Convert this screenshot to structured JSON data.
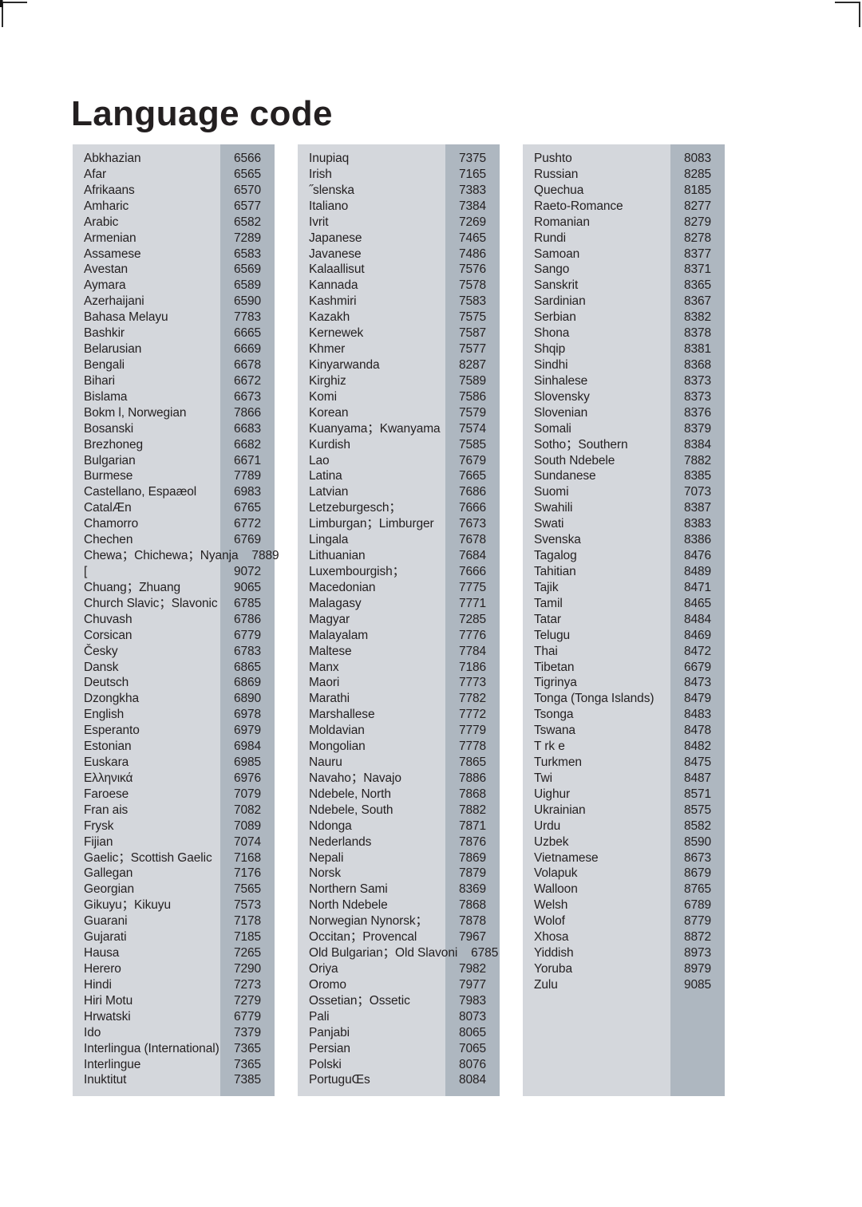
{
  "page": {
    "title": "Language code",
    "colors": {
      "band_light": "#d4d7dc",
      "band_dark": "#aeb7c0",
      "text": "#231f20"
    }
  },
  "columns": [
    {
      "id": "column-1",
      "entries": [
        {
          "language": "Abkhazian",
          "code": "6566"
        },
        {
          "language": "Afar",
          "code": "6565"
        },
        {
          "language": "Afrikaans",
          "code": "6570"
        },
        {
          "language": "Amharic",
          "code": "6577"
        },
        {
          "language": "Arabic",
          "code": "6582"
        },
        {
          "language": "Armenian",
          "code": "7289"
        },
        {
          "language": "Assamese",
          "code": "6583"
        },
        {
          "language": "Avestan",
          "code": "6569"
        },
        {
          "language": "Aymara",
          "code": "6589"
        },
        {
          "language": "Azerhaijani",
          "code": "6590"
        },
        {
          "language": "Bahasa Melayu",
          "code": "7783"
        },
        {
          "language": "Bashkir",
          "code": "6665"
        },
        {
          "language": "Belarusian",
          "code": "6669"
        },
        {
          "language": "Bengali",
          "code": "6678"
        },
        {
          "language": "Bihari",
          "code": "6672"
        },
        {
          "language": "Bislama",
          "code": "6673"
        },
        {
          "language": "Bokm l, Norwegian",
          "code": "7866"
        },
        {
          "language": "Bosanski",
          "code": "6683"
        },
        {
          "language": "Brezhoneg",
          "code": "6682"
        },
        {
          "language": "Bulgarian",
          "code": "6671"
        },
        {
          "language": "Burmese",
          "code": "7789"
        },
        {
          "language": "Castellano, Espaæol",
          "code": "6983"
        },
        {
          "language": "CatalÆn",
          "code": "6765"
        },
        {
          "language": "Chamorro",
          "code": "6772"
        },
        {
          "language": "Chechen",
          "code": "6769"
        },
        {
          "language": "Chewa；Chichewa；Nyanja",
          "code": "7889"
        },
        {
          "language": "[",
          "code": "9072"
        },
        {
          "language": "Chuang；Zhuang",
          "code": "9065"
        },
        {
          "language": "Church Slavic；Slavonic",
          "code": "6785"
        },
        {
          "language": "Chuvash",
          "code": "6786"
        },
        {
          "language": "Corsican",
          "code": "6779"
        },
        {
          "language": "Česky",
          "code": "6783"
        },
        {
          "language": "Dansk",
          "code": "6865"
        },
        {
          "language": "Deutsch",
          "code": "6869"
        },
        {
          "language": "Dzongkha",
          "code": "6890"
        },
        {
          "language": "English",
          "code": "6978"
        },
        {
          "language": "Esperanto",
          "code": "6979"
        },
        {
          "language": "Estonian",
          "code": "6984"
        },
        {
          "language": "Euskara",
          "code": "6985"
        },
        {
          "language": "Ελληνικά",
          "code": "6976"
        },
        {
          "language": "Faroese",
          "code": "7079"
        },
        {
          "language": "Fran ais",
          "code": "7082"
        },
        {
          "language": "Frysk",
          "code": "7089"
        },
        {
          "language": "Fijian",
          "code": "7074"
        },
        {
          "language": "Gaelic；Scottish Gaelic",
          "code": "7168"
        },
        {
          "language": "Gallegan",
          "code": "7176"
        },
        {
          "language": "Georgian",
          "code": "7565"
        },
        {
          "language": "Gikuyu；Kikuyu",
          "code": "7573"
        },
        {
          "language": "Guarani",
          "code": "7178"
        },
        {
          "language": "Gujarati",
          "code": "7185"
        },
        {
          "language": "Hausa",
          "code": "7265"
        },
        {
          "language": "Herero",
          "code": "7290"
        },
        {
          "language": "Hindi",
          "code": "7273"
        },
        {
          "language": "Hiri Motu",
          "code": "7279"
        },
        {
          "language": "Hrwatski",
          "code": "6779"
        },
        {
          "language": "Ido",
          "code": "7379"
        },
        {
          "language": "Interlingua (International)",
          "code": "7365"
        },
        {
          "language": "Interlingue",
          "code": "7365"
        },
        {
          "language": "Inuktitut",
          "code": "7385"
        }
      ]
    },
    {
      "id": "column-2",
      "entries": [
        {
          "language": "Inupiaq",
          "code": "7375"
        },
        {
          "language": "Irish",
          "code": "7165"
        },
        {
          "language": "˝slenska",
          "code": "7383"
        },
        {
          "language": "Italiano",
          "code": "7384"
        },
        {
          "language": "Ivrit",
          "code": "7269"
        },
        {
          "language": "Japanese",
          "code": "7465"
        },
        {
          "language": "Javanese",
          "code": "7486"
        },
        {
          "language": "Kalaallisut",
          "code": "7576"
        },
        {
          "language": "Kannada",
          "code": "7578"
        },
        {
          "language": "Kashmiri",
          "code": "7583"
        },
        {
          "language": "Kazakh",
          "code": "7575"
        },
        {
          "language": "Kernewek",
          "code": "7587"
        },
        {
          "language": "Khmer",
          "code": "7577"
        },
        {
          "language": "Kinyarwanda",
          "code": "8287"
        },
        {
          "language": "Kirghiz",
          "code": "7589"
        },
        {
          "language": "Komi",
          "code": "7586"
        },
        {
          "language": "Korean",
          "code": "7579"
        },
        {
          "language": "Kuanyama；Kwanyama",
          "code": "7574"
        },
        {
          "language": "Kurdish",
          "code": "7585"
        },
        {
          "language": "Lao",
          "code": "7679"
        },
        {
          "language": "Latina",
          "code": "7665"
        },
        {
          "language": "Latvian",
          "code": "7686"
        },
        {
          "language": "Letzeburgesch；",
          "code": "7666"
        },
        {
          "language": "Limburgan；Limburger",
          "code": "7673"
        },
        {
          "language": "Lingala",
          "code": "7678"
        },
        {
          "language": "Lithuanian",
          "code": "7684"
        },
        {
          "language": "Luxembourgish；",
          "code": "7666"
        },
        {
          "language": "Macedonian",
          "code": "7775"
        },
        {
          "language": "Malagasy",
          "code": "7771"
        },
        {
          "language": "Magyar",
          "code": "7285"
        },
        {
          "language": "Malayalam",
          "code": "7776"
        },
        {
          "language": "Maltese",
          "code": "7784"
        },
        {
          "language": "Manx",
          "code": "7186"
        },
        {
          "language": "Maori",
          "code": "7773"
        },
        {
          "language": "Marathi",
          "code": "7782"
        },
        {
          "language": "Marshallese",
          "code": "7772"
        },
        {
          "language": "Moldavian",
          "code": "7779"
        },
        {
          "language": "Mongolian",
          "code": "7778"
        },
        {
          "language": "Nauru",
          "code": "7865"
        },
        {
          "language": "Navaho；Navajo",
          "code": "7886"
        },
        {
          "language": "Ndebele, North",
          "code": "7868"
        },
        {
          "language": "Ndebele, South",
          "code": "7882"
        },
        {
          "language": "Ndonga",
          "code": "7871"
        },
        {
          "language": "Nederlands",
          "code": "7876"
        },
        {
          "language": "Nepali",
          "code": "7869"
        },
        {
          "language": "Norsk",
          "code": "7879"
        },
        {
          "language": "Northern Sami",
          "code": "8369"
        },
        {
          "language": "North Ndebele",
          "code": "7868"
        },
        {
          "language": "Norwegian Nynorsk；",
          "code": "7878"
        },
        {
          "language": "Occitan；Provencal",
          "code": "7967"
        },
        {
          "language": "Old Bulgarian；Old Slavoni",
          "code": "6785"
        },
        {
          "language": "Oriya",
          "code": "7982"
        },
        {
          "language": "Oromo",
          "code": "7977"
        },
        {
          "language": "Ossetian；Ossetic",
          "code": "7983"
        },
        {
          "language": "Pali",
          "code": "8073"
        },
        {
          "language": "Panjabi",
          "code": "8065"
        },
        {
          "language": "Persian",
          "code": "7065"
        },
        {
          "language": "Polski",
          "code": "8076"
        },
        {
          "language": "PortuguŒs",
          "code": "8084"
        }
      ]
    },
    {
      "id": "column-3",
      "entries": [
        {
          "language": "Pushto",
          "code": "8083"
        },
        {
          "language": "Russian",
          "code": "8285"
        },
        {
          "language": "Quechua",
          "code": "8185"
        },
        {
          "language": "Raeto-Romance",
          "code": "8277"
        },
        {
          "language": "Romanian",
          "code": "8279"
        },
        {
          "language": "Rundi",
          "code": "8278"
        },
        {
          "language": "Samoan",
          "code": "8377"
        },
        {
          "language": "Sango",
          "code": "8371"
        },
        {
          "language": "Sanskrit",
          "code": "8365"
        },
        {
          "language": "Sardinian",
          "code": "8367"
        },
        {
          "language": "Serbian",
          "code": "8382"
        },
        {
          "language": "Shona",
          "code": "8378"
        },
        {
          "language": "Shqip",
          "code": "8381"
        },
        {
          "language": "Sindhi",
          "code": "8368"
        },
        {
          "language": "Sinhalese",
          "code": "8373"
        },
        {
          "language": "Slovensky",
          "code": "8373"
        },
        {
          "language": "Slovenian",
          "code": "8376"
        },
        {
          "language": "Somali",
          "code": "8379"
        },
        {
          "language": "Sotho；Southern",
          "code": "8384"
        },
        {
          "language": "South Ndebele",
          "code": "7882"
        },
        {
          "language": "Sundanese",
          "code": "8385"
        },
        {
          "language": "Suomi",
          "code": "7073"
        },
        {
          "language": "Swahili",
          "code": "8387"
        },
        {
          "language": "Swati",
          "code": "8383"
        },
        {
          "language": "Svenska",
          "code": "8386"
        },
        {
          "language": "Tagalog",
          "code": "8476"
        },
        {
          "language": "Tahitian",
          "code": "8489"
        },
        {
          "language": "Tajik",
          "code": "8471"
        },
        {
          "language": "Tamil",
          "code": "8465"
        },
        {
          "language": "Tatar",
          "code": "8484"
        },
        {
          "language": "Telugu",
          "code": "8469"
        },
        {
          "language": "Thai",
          "code": "8472"
        },
        {
          "language": "Tibetan",
          "code": "6679"
        },
        {
          "language": "Tigrinya",
          "code": "8473"
        },
        {
          "language": "Tonga (Tonga Islands)",
          "code": "8479"
        },
        {
          "language": "Tsonga",
          "code": "8483"
        },
        {
          "language": "Tswana",
          "code": "8478"
        },
        {
          "language": "T rk e",
          "code": "8482"
        },
        {
          "language": "Turkmen",
          "code": "8475"
        },
        {
          "language": "Twi",
          "code": "8487"
        },
        {
          "language": "Uighur",
          "code": "8571"
        },
        {
          "language": "Ukrainian",
          "code": "8575"
        },
        {
          "language": "Urdu",
          "code": "8582"
        },
        {
          "language": "Uzbek",
          "code": "8590"
        },
        {
          "language": "Vietnamese",
          "code": "8673"
        },
        {
          "language": "Volapuk",
          "code": "8679"
        },
        {
          "language": "Walloon",
          "code": "8765"
        },
        {
          "language": "Welsh",
          "code": "6789"
        },
        {
          "language": "Wolof",
          "code": "8779"
        },
        {
          "language": "Xhosa",
          "code": "8872"
        },
        {
          "language": "Yiddish",
          "code": "8973"
        },
        {
          "language": "Yoruba",
          "code": "8979"
        },
        {
          "language": "Zulu",
          "code": "9085"
        }
      ]
    }
  ]
}
